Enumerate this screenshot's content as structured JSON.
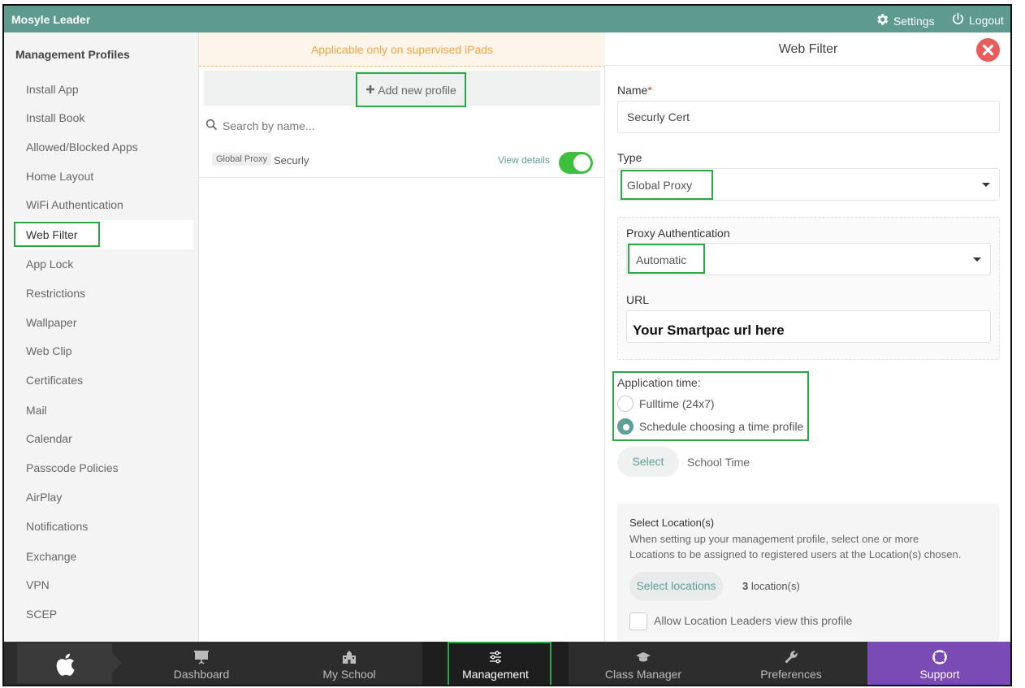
{
  "app": {
    "title": "Mosyle Leader",
    "settings_label": "Settings",
    "logout_label": "Logout"
  },
  "sidebar": {
    "title": "Management Profiles",
    "items": [
      "Install App",
      "Install Book",
      "Allowed/Blocked Apps",
      "Home Layout",
      "WiFi Authentication",
      "Web Filter",
      "App Lock",
      "Restrictions",
      "Wallpaper",
      "Web Clip",
      "Certificates",
      "Mail",
      "Calendar",
      "Passcode Policies",
      "AirPlay",
      "Notifications",
      "Exchange",
      "VPN",
      "SCEP"
    ],
    "active": "Web Filter"
  },
  "middle": {
    "notice": "Applicable only on supervised iPads",
    "add_label": "Add new profile",
    "search_placeholder": "Search by name...",
    "profiles": [
      {
        "chip": "Global Proxy",
        "name": "Securly",
        "action": "View details",
        "enabled": true
      }
    ]
  },
  "panel": {
    "title": "Web Filter",
    "name_label": "Name",
    "name_required": "*",
    "name_value": "Securly Cert",
    "type_label": "Type",
    "type_value": "Global Proxy",
    "proxy_auth_label": "Proxy Authentication",
    "proxy_auth_value": "Automatic",
    "url_label": "URL",
    "url_value": "Your Smartpac url here",
    "app_time_label": "Application time:",
    "option_fulltime": "Fulltime (24x7)",
    "option_schedule": "Schedule choosing a time profile",
    "selected_option": "schedule",
    "select_btn": "Select",
    "time_profile": "School Time",
    "locations": {
      "title": "Select Location(s)",
      "description_line1": "When setting up your management profile, select one or more",
      "description_line2": "Locations to be assigned to registered users at the Location(s) chosen.",
      "select_btn": "Select locations",
      "count": "3",
      "count_suffix": " location(s)",
      "allow_label": "Allow Location Leaders view this profile"
    }
  },
  "bottom_nav": {
    "items": [
      "Dashboard",
      "My School",
      "Management",
      "Class Manager",
      "Preferences",
      "Support"
    ],
    "active": "Management"
  }
}
